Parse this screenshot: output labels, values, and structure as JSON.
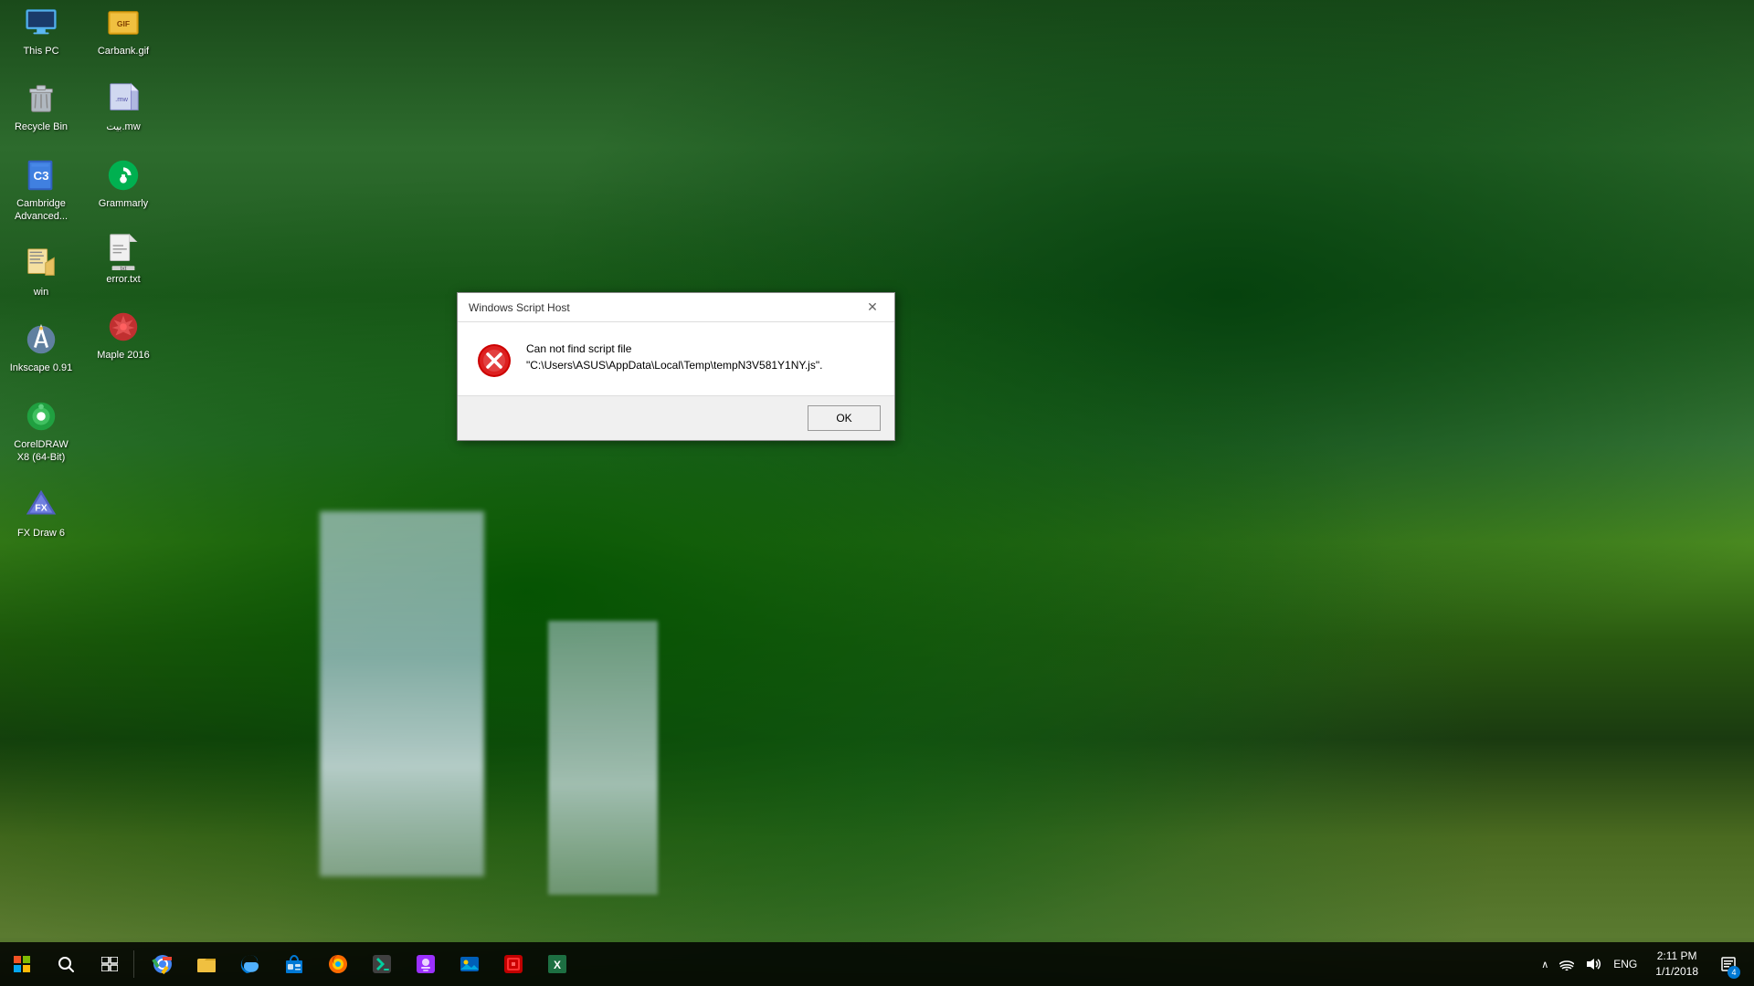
{
  "desktop": {
    "background": "waterfall forest"
  },
  "icons": {
    "left_column": [
      {
        "id": "this-pc",
        "label": "This PC",
        "icon": "pc",
        "emoji": "💻"
      },
      {
        "id": "recycle-bin",
        "label": "Recycle Bin",
        "icon": "recycle",
        "emoji": "🗑️"
      },
      {
        "id": "cambridge",
        "label": "Cambridge Advanced...",
        "icon": "cambridge",
        "emoji": "📘"
      },
      {
        "id": "win",
        "label": "win",
        "icon": "win",
        "emoji": "📄"
      },
      {
        "id": "inkscape",
        "label": "Inkscape 0.91",
        "icon": "inkscape",
        "emoji": "✏️"
      },
      {
        "id": "coreldraw",
        "label": "CorelDRAW X8 (64-Bit)",
        "icon": "coreldraw",
        "emoji": "🎨"
      },
      {
        "id": "fxdraw",
        "label": "FX Draw 6",
        "icon": "fxdraw",
        "emoji": "💠"
      }
    ],
    "right_column": [
      {
        "id": "carbank",
        "label": "Carbank.gif",
        "icon": "gif",
        "emoji": "🖼️"
      },
      {
        "id": "mw",
        "label": "بيت.mw",
        "icon": "mw",
        "emoji": "📝"
      },
      {
        "id": "grammarly",
        "label": "Grammarly",
        "icon": "grammarly",
        "emoji": "🟢"
      },
      {
        "id": "error-txt",
        "label": "error.txt",
        "icon": "error",
        "emoji": "📄"
      },
      {
        "id": "maple",
        "label": "Maple 2016",
        "icon": "maple",
        "emoji": "🍁"
      }
    ]
  },
  "dialog": {
    "title": "Windows Script Host",
    "message_line1": "Can not find script file",
    "message_line2": "\"C:\\Users\\ASUS\\AppData\\Local\\Temp\\tempN3V581Y1NY.js\".",
    "ok_button": "OK"
  },
  "taskbar": {
    "start_icon": "⊞",
    "search_icon": "🔍",
    "task_view_icon": "⧉",
    "apps": [
      {
        "id": "chrome",
        "emoji": "🌐",
        "label": "Chrome"
      },
      {
        "id": "explorer",
        "emoji": "📁",
        "label": "File Explorer"
      },
      {
        "id": "edge",
        "emoji": "🌍",
        "label": "Edge"
      },
      {
        "id": "store",
        "emoji": "🛍️",
        "label": "Microsoft Store"
      },
      {
        "id": "firefox",
        "emoji": "🦊",
        "label": "Firefox"
      },
      {
        "id": "vscode",
        "emoji": "💻",
        "label": "VS Code"
      },
      {
        "id": "purple-app",
        "emoji": "🟣",
        "label": "App"
      },
      {
        "id": "photos",
        "emoji": "🖼️",
        "label": "Photos"
      },
      {
        "id": "app8",
        "emoji": "🎯",
        "label": "App"
      },
      {
        "id": "excel",
        "emoji": "📊",
        "label": "Excel"
      }
    ],
    "tray": {
      "time": "2:11 PM",
      "date": "1/1/2018",
      "language": "ENG",
      "notification_count": "4"
    }
  }
}
